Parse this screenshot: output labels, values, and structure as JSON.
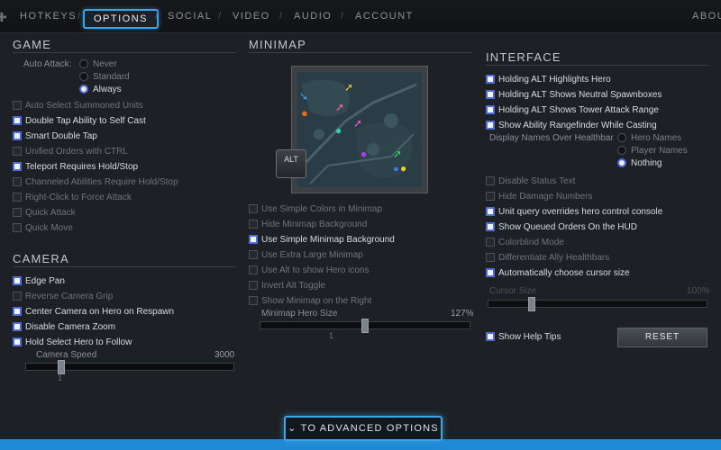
{
  "nav": {
    "items": [
      "HOTKEYS",
      "OPTIONS",
      "SOCIAL",
      "VIDEO",
      "AUDIO",
      "ACCOUNT"
    ],
    "active": "OPTIONS",
    "right": "ABOU"
  },
  "game": {
    "title": "GAME",
    "auto_attack_label": "Auto Attack:",
    "auto_attack_options": [
      "Never",
      "Standard",
      "Always"
    ],
    "auto_attack_selected": "Always",
    "checkboxes": [
      {
        "label": "Auto Select Summoned Units",
        "checked": false
      },
      {
        "label": "Double Tap Ability to Self Cast",
        "checked": true
      },
      {
        "label": "Smart Double Tap",
        "checked": true
      },
      {
        "label": "Unified Orders with CTRL",
        "checked": false
      },
      {
        "label": "Teleport Requires Hold/Stop",
        "checked": true
      },
      {
        "label": "Channeled Abilities Require Hold/Stop",
        "checked": false
      },
      {
        "label": "Right-Click to Force Attack",
        "checked": false
      },
      {
        "label": "Quick Attack",
        "checked": false
      },
      {
        "label": "Quick Move",
        "checked": false
      }
    ]
  },
  "camera": {
    "title": "CAMERA",
    "checkboxes": [
      {
        "label": "Edge Pan",
        "checked": true
      },
      {
        "label": "Reverse Camera Grip",
        "checked": false
      },
      {
        "label": "Center Camera on Hero on Respawn",
        "checked": true
      },
      {
        "label": "Disable Camera Zoom",
        "checked": true
      },
      {
        "label": "Hold Select Hero to Follow",
        "checked": true
      }
    ],
    "speed_label": "Camera Speed",
    "speed_max": "3000",
    "speed_min": "1",
    "speed_fraction": 0.17
  },
  "minimap": {
    "title": "MINIMAP",
    "alt_key": "ALT",
    "checkboxes": [
      {
        "label": "Use Simple Colors in Minimap",
        "checked": false
      },
      {
        "label": "Hide Minimap Background",
        "checked": false
      },
      {
        "label": "Use Simple Minimap Background",
        "checked": true
      },
      {
        "label": "Use Extra Large Minimap",
        "checked": false
      },
      {
        "label": "Use Alt to show Hero icons",
        "checked": false
      },
      {
        "label": "Invert Alt Toggle",
        "checked": false
      },
      {
        "label": "Show Minimap on the Right",
        "checked": false
      }
    ],
    "hero_size_label": "Minimap Hero Size",
    "hero_size_value": "127%",
    "hero_size_min": "1",
    "hero_size_fraction": 0.5
  },
  "interface": {
    "title": "INTERFACE",
    "checkboxes_top": [
      {
        "label": "Holding ALT Highlights Hero",
        "checked": true
      },
      {
        "label": "Holding ALT Shows Neutral Spawnboxes",
        "checked": true
      },
      {
        "label": "Holding ALT Shows Tower Attack Range",
        "checked": true
      },
      {
        "label": "Show Ability Rangefinder While Casting",
        "checked": true
      }
    ],
    "names_label": "Display Names Over Healthbar",
    "names_options": [
      "Hero Names",
      "Player Names",
      "Nothing"
    ],
    "names_selected": "Nothing",
    "checkboxes_bottom": [
      {
        "label": "Disable Status Text",
        "checked": false
      },
      {
        "label": "Hide Damage Numbers",
        "checked": false
      },
      {
        "label": "Unit query overrides hero control console",
        "checked": true
      },
      {
        "label": "Show Queued Orders On the HUD",
        "checked": true
      },
      {
        "label": "Colorblind Mode",
        "checked": false
      },
      {
        "label": "Differentiate Ally Healthbars",
        "checked": false
      },
      {
        "label": "Automatically choose cursor size",
        "checked": true
      }
    ],
    "cursor_size_label": "Cursor Size",
    "cursor_size_value": "100%",
    "cursor_size_fraction": 0.2,
    "help_tips": {
      "label": "Show Help Tips",
      "checked": true
    },
    "reset_label": "RESET"
  },
  "advanced_label": "TO ADVANCED OPTIONS",
  "colors": {
    "accent": "#3aa8e8",
    "check": "#4f6bd8",
    "bg": "#1d2024"
  }
}
